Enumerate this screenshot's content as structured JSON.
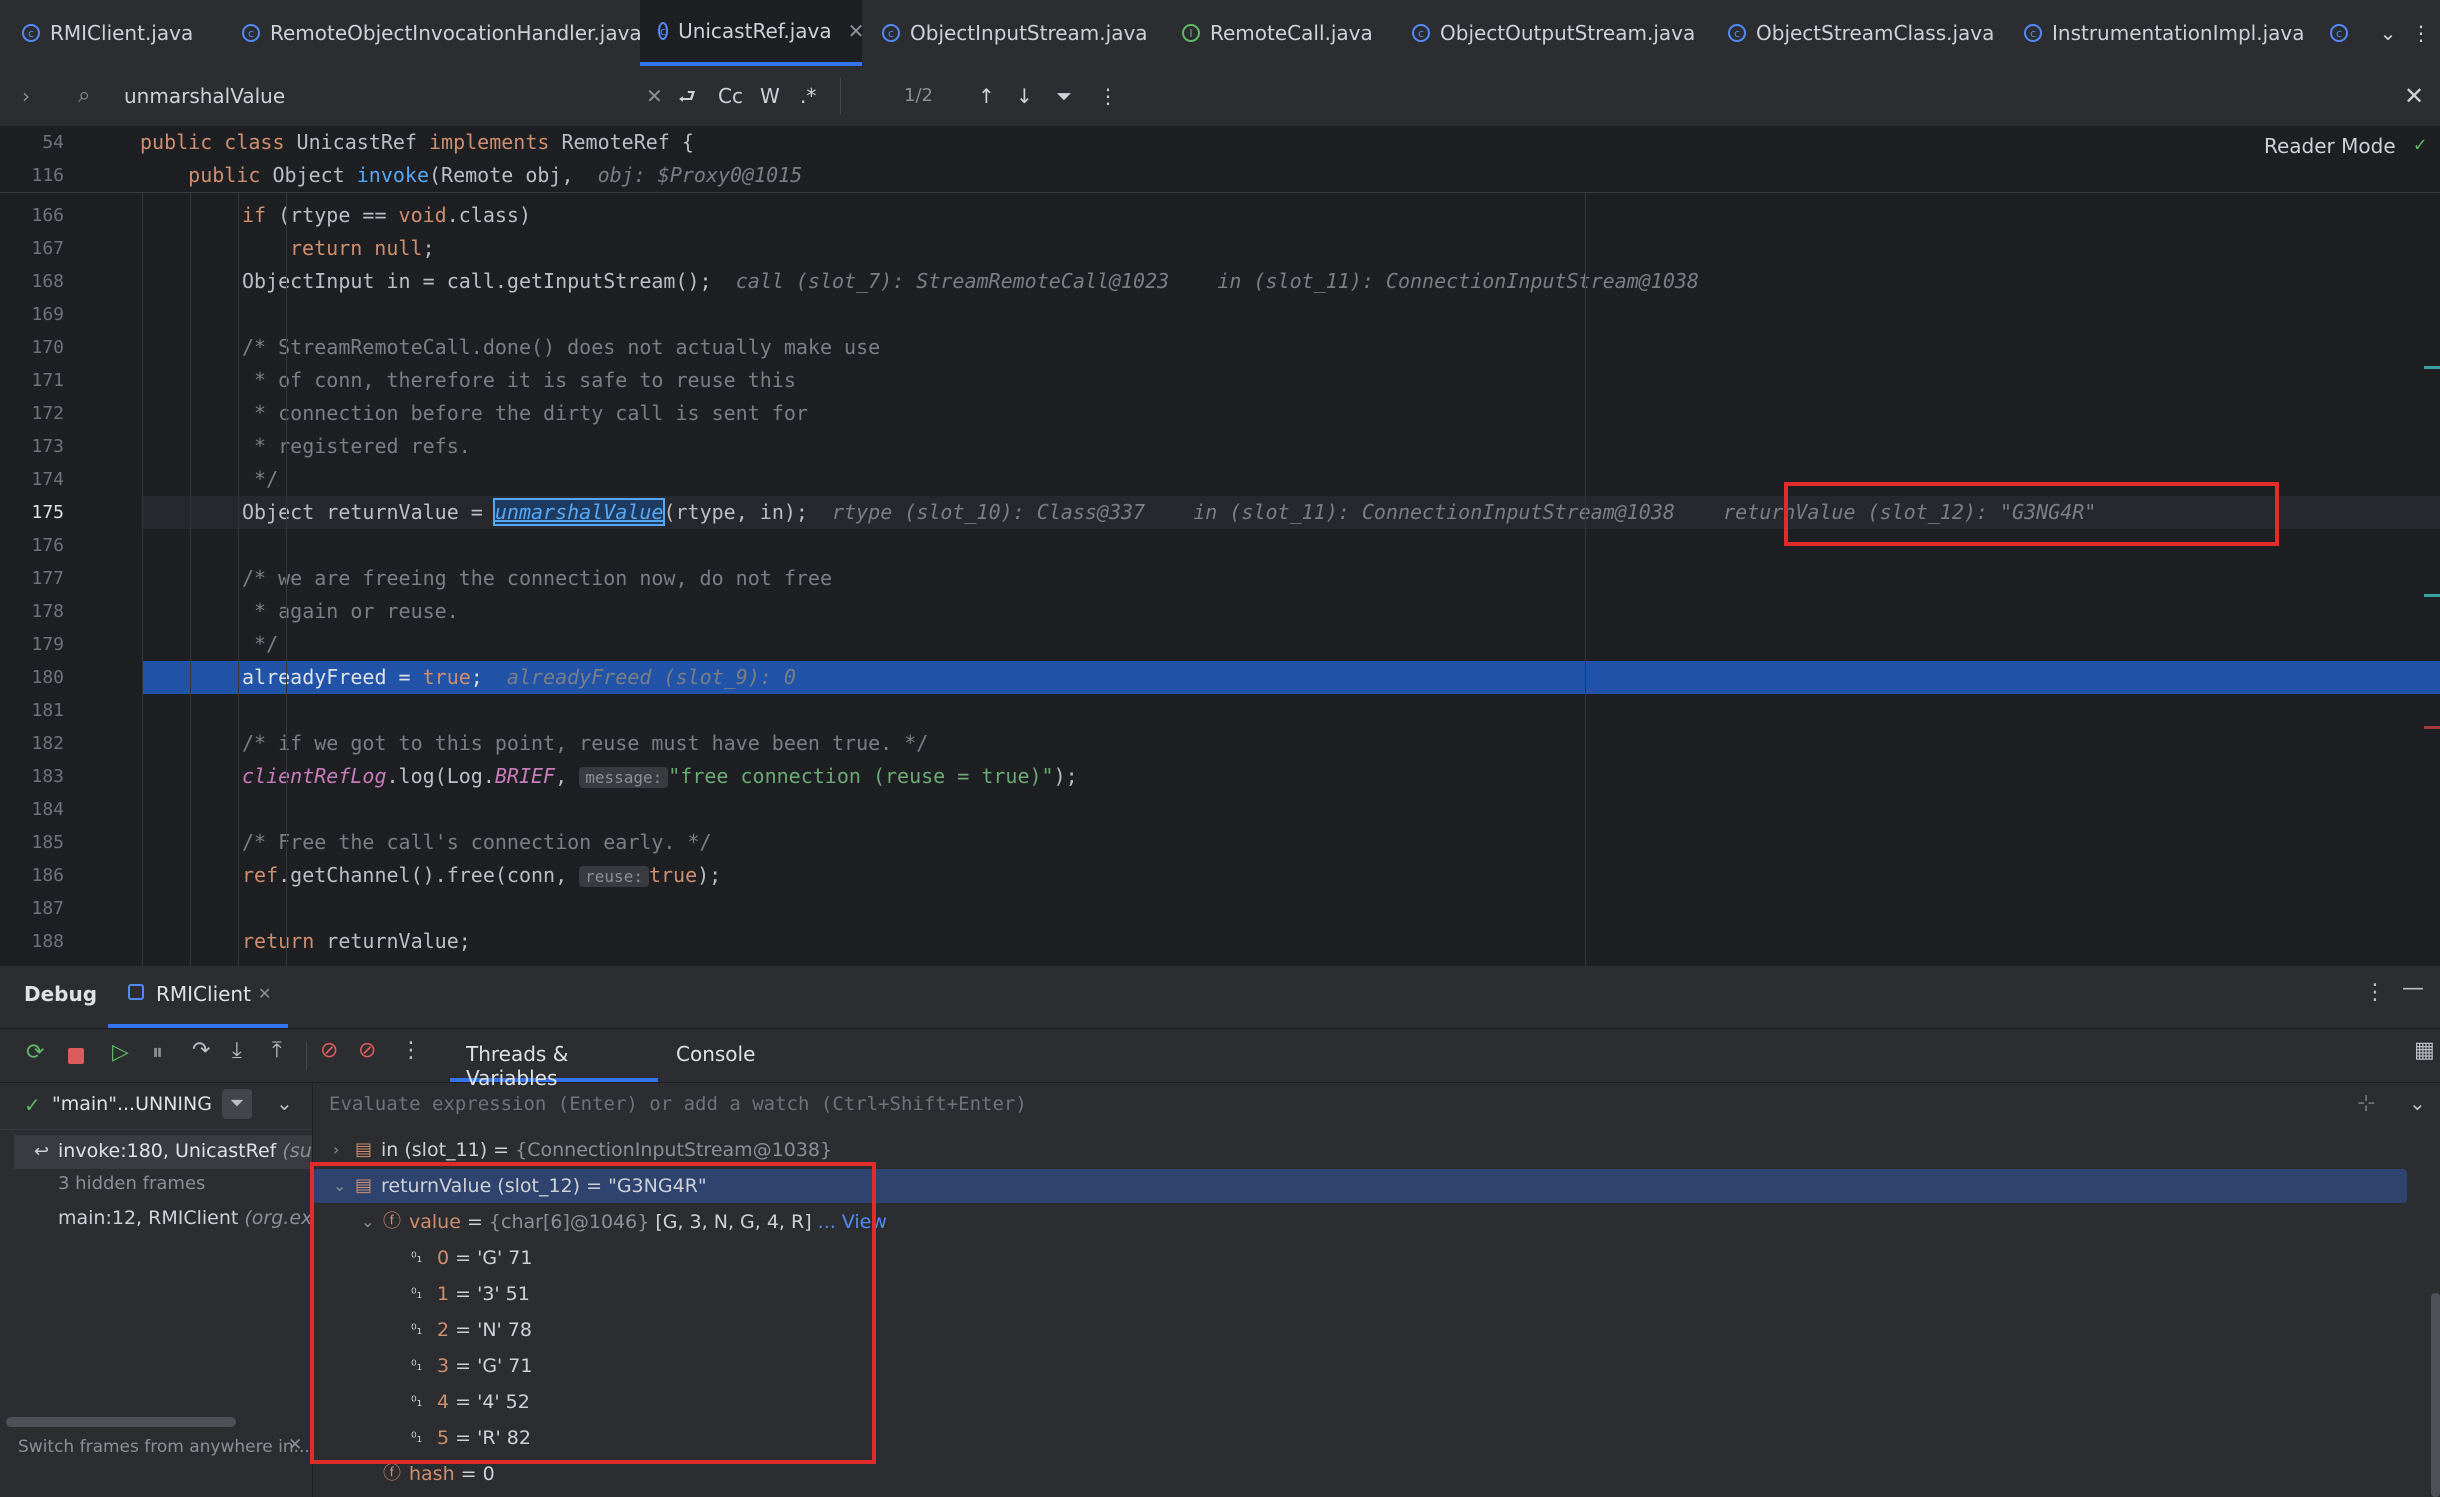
{
  "tabs": [
    {
      "label": "RMIClient.java",
      "icon": "class-icon"
    },
    {
      "label": "RemoteObjectInvocationHandler.java",
      "icon": "class-icon"
    },
    {
      "label": "UnicastRef.java",
      "icon": "class-icon",
      "active": true
    },
    {
      "label": "ObjectInputStream.java",
      "icon": "class-icon"
    },
    {
      "label": "RemoteCall.java",
      "icon": "interface-icon"
    },
    {
      "label": "ObjectOutputStream.java",
      "icon": "class-icon"
    },
    {
      "label": "ObjectStreamClass.java",
      "icon": "class-icon"
    },
    {
      "label": "InstrumentationImpl.java",
      "icon": "class-icon"
    }
  ],
  "find": {
    "query": "unmarshalValue",
    "count": "1/2",
    "cc": "Cc",
    "w": "W",
    "regex": ".*"
  },
  "editor": {
    "reader_mode": "Reader Mode"
  },
  "sticky": [
    {
      "ln": "54",
      "tokens": [
        [
          "kw",
          "public class "
        ],
        [
          "",
          "UnicastRef "
        ],
        [
          "kw",
          "implements "
        ],
        [
          "",
          "RemoteRef {"
        ]
      ]
    },
    {
      "ln": "116",
      "tokens": [
        [
          "",
          "    "
        ],
        [
          "kw",
          "public "
        ],
        [
          "",
          "Object "
        ],
        [
          "fn",
          "invoke"
        ],
        [
          "",
          "(Remote obj,  "
        ],
        [
          "hint",
          "obj: $Proxy0@1015"
        ]
      ]
    }
  ],
  "lines": [
    {
      "ln": "166",
      "indent": 2,
      "tokens": [
        [
          "kw",
          "if "
        ],
        [
          "",
          "(rtype == "
        ],
        [
          "kw",
          "void"
        ],
        [
          "",
          ".class)"
        ]
      ]
    },
    {
      "ln": "167",
      "indent": 3,
      "tokens": [
        [
          "kw",
          "return null"
        ],
        [
          "",
          ";"
        ]
      ]
    },
    {
      "ln": "168",
      "indent": 2,
      "tokens": [
        [
          "",
          "ObjectInput in = call.getInputStream();  "
        ],
        [
          "hint",
          "call (slot_7): StreamRemoteCall@1023    in (slot_11): ConnectionInputStream@1038"
        ]
      ]
    },
    {
      "ln": "169",
      "indent": 2,
      "tokens": []
    },
    {
      "ln": "170",
      "indent": 2,
      "tokens": [
        [
          "cm",
          "/* StreamRemoteCall.done() does not actually make use"
        ]
      ]
    },
    {
      "ln": "171",
      "indent": 2,
      "tokens": [
        [
          "cm",
          " * of conn, therefore it is safe to reuse this"
        ]
      ]
    },
    {
      "ln": "172",
      "indent": 2,
      "tokens": [
        [
          "cm",
          " * connection before the dirty call is sent for"
        ]
      ]
    },
    {
      "ln": "173",
      "indent": 2,
      "tokens": [
        [
          "cm",
          " * registered refs."
        ]
      ]
    },
    {
      "ln": "174",
      "indent": 2,
      "tokens": [
        [
          "cm",
          " */"
        ]
      ]
    },
    {
      "ln": "175",
      "indent": 2,
      "tokens": [
        [
          "",
          "Object returnValue = "
        ],
        [
          "fnhl",
          "unmarshalValue"
        ],
        [
          "",
          "(rtype, in);  "
        ],
        [
          "hint",
          "rtype (slot_10): Class@337    in (slot_11): ConnectionInputStream@1038    returnValue (slot_12): \"G3NG4R\""
        ]
      ]
    },
    {
      "ln": "176",
      "indent": 2,
      "tokens": []
    },
    {
      "ln": "177",
      "indent": 2,
      "tokens": [
        [
          "cm",
          "/* we are freeing the connection now, do not free"
        ]
      ]
    },
    {
      "ln": "178",
      "indent": 2,
      "tokens": [
        [
          "cm",
          " * again or reuse."
        ]
      ]
    },
    {
      "ln": "179",
      "indent": 2,
      "tokens": [
        [
          "cm",
          " */"
        ]
      ]
    },
    {
      "ln": "180",
      "indent": 2,
      "current": true,
      "tokens": [
        [
          "",
          "alreadyFreed = "
        ],
        [
          "kw",
          "true"
        ],
        [
          "",
          ";  "
        ],
        [
          "hint",
          "alreadyFreed (slot_9): 0"
        ]
      ]
    },
    {
      "ln": "181",
      "indent": 2,
      "tokens": []
    },
    {
      "ln": "182",
      "indent": 2,
      "tokens": [
        [
          "cm",
          "/* if we got to this point, reuse must have been true. */"
        ]
      ]
    },
    {
      "ln": "183",
      "indent": 2,
      "tokens": [
        [
          "it",
          "clientRefLog"
        ],
        [
          "",
          ".log(Log."
        ],
        [
          "it",
          "BRIEF"
        ],
        [
          "",
          ", "
        ],
        [
          "ph",
          "message:"
        ],
        [
          "st",
          "\"free connection (reuse = true)\""
        ],
        [
          "",
          ");"
        ]
      ]
    },
    {
      "ln": "184",
      "indent": 2,
      "tokens": []
    },
    {
      "ln": "185",
      "indent": 2,
      "tokens": [
        [
          "cm",
          "/* Free the call's connection early. */"
        ]
      ]
    },
    {
      "ln": "186",
      "indent": 2,
      "tokens": [
        [
          "kw",
          "ref"
        ],
        [
          "",
          ".getChannel().free(conn, "
        ],
        [
          "ph",
          "reuse:"
        ],
        [
          "kw",
          "true"
        ],
        [
          "",
          ");"
        ]
      ]
    },
    {
      "ln": "187",
      "indent": 2,
      "tokens": []
    },
    {
      "ln": "188",
      "indent": 2,
      "tokens": [
        [
          "kw",
          "return "
        ],
        [
          "",
          "returnValue;"
        ]
      ]
    }
  ],
  "debug": {
    "title": "Debug",
    "session": "RMIClient",
    "tabs": [
      "Threads & Variables",
      "Console"
    ],
    "thread": "\"main\"...UNNING",
    "frames": [
      {
        "label": "invoke:180, UnicastRef",
        "pkg": "(sun.rmi",
        "selected": true
      },
      {
        "label": "3 hidden frames",
        "pkg": ""
      },
      {
        "label": "main:12, RMIClient",
        "pkg": "(org.exam"
      }
    ],
    "frames_footer": "Switch frames from anywhere in...",
    "eval_placeholder": "Evaluate expression (Enter) or add a watch (Ctrl+Shift+Enter)",
    "vars": [
      {
        "name": "in (slot_11)",
        "eq": " = ",
        "val": "{ConnectionInputStream@1038}",
        "level": 0,
        "arrow": ">"
      },
      {
        "name": "returnValue (slot_12)",
        "eq": " = ",
        "val": "\"G3NG4R\"",
        "level": 0,
        "arrow": "v",
        "selected": true
      },
      {
        "name": "value",
        "eq": " = ",
        "type": "{char[6]@1046}",
        "val": "[G, 3, N, G, 4, R]",
        "link": "... View",
        "level": 1,
        "arrow": "v"
      },
      {
        "name": "0",
        "eq": " = ",
        "val": "'G' 71",
        "level": 2
      },
      {
        "name": "1",
        "eq": " = ",
        "val": "'3' 51",
        "level": 2
      },
      {
        "name": "2",
        "eq": " = ",
        "val": "'N' 78",
        "level": 2
      },
      {
        "name": "3",
        "eq": " = ",
        "val": "'G' 71",
        "level": 2
      },
      {
        "name": "4",
        "eq": " = ",
        "val": "'4' 52",
        "level": 2
      },
      {
        "name": "5",
        "eq": " = ",
        "val": "'R' 82",
        "level": 2
      },
      {
        "name": "hash",
        "eq": " = ",
        "val": "0",
        "level": 1
      }
    ]
  },
  "colors": {
    "accent": "#3574f0",
    "highlight_box": "#e32b2b",
    "current_line": "#2154a8"
  }
}
